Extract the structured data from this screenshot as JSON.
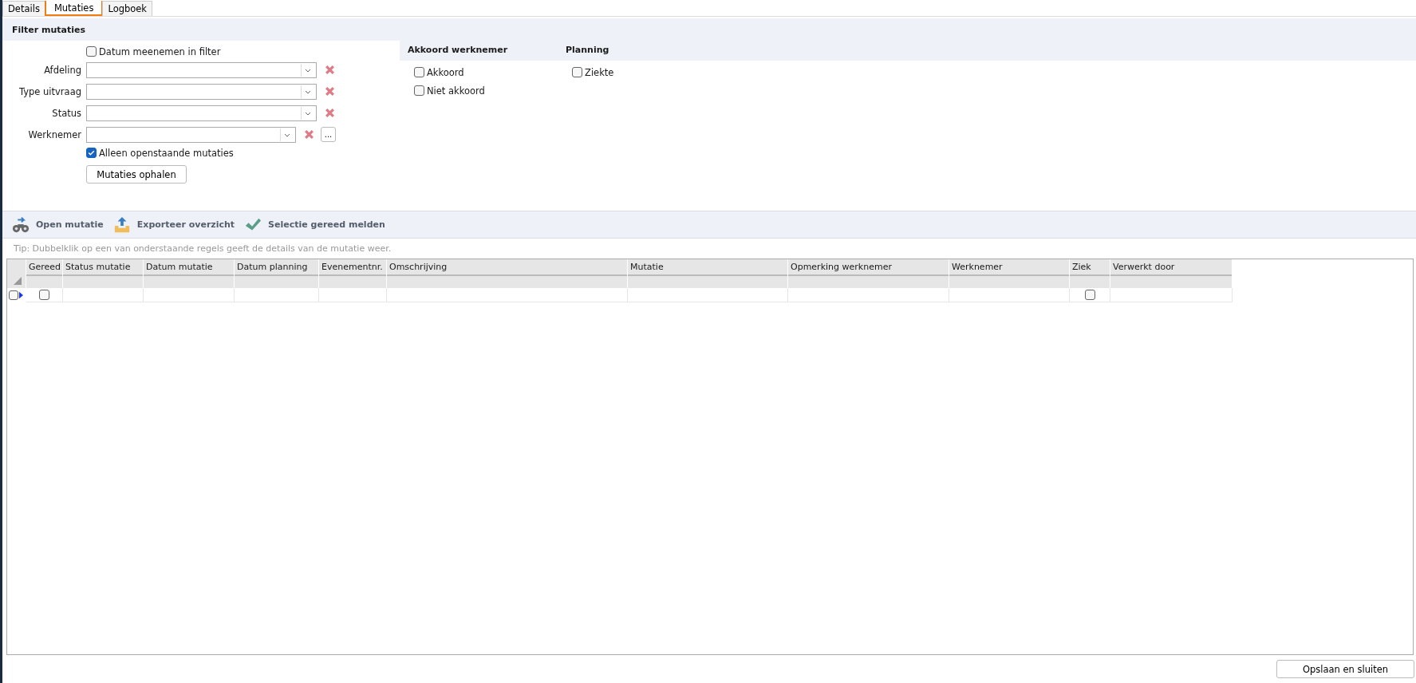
{
  "tabs": [
    {
      "label": "Details",
      "selected": false
    },
    {
      "label": "Mutaties",
      "selected": true
    },
    {
      "label": "Logboek",
      "selected": false
    }
  ],
  "filter": {
    "title": "Filter mutaties",
    "date_option": {
      "label": "Datum meenemen in filter",
      "checked": false
    },
    "fields": [
      {
        "label": "Afdeling"
      },
      {
        "label": "Type uitvraag"
      },
      {
        "label": "Status"
      },
      {
        "label": "Werknemer",
        "browse": "..."
      }
    ],
    "open_only": {
      "label": "Alleen openstaande mutaties",
      "checked": true
    },
    "fetch_button": "Mutaties ophalen"
  },
  "groups": [
    {
      "title": "Akkoord werknemer",
      "options": [
        {
          "label": "Akkoord",
          "checked": false
        },
        {
          "label": "Niet akkoord",
          "checked": false
        }
      ]
    },
    {
      "title": "Planning",
      "options": [
        {
          "label": "Ziekte",
          "checked": false
        }
      ]
    }
  ],
  "toolbar": [
    {
      "kind": "open",
      "label": "Open mutatie"
    },
    {
      "kind": "export",
      "label": "Exporteer overzicht"
    },
    {
      "kind": "done",
      "label": "Selectie gereed melden"
    }
  ],
  "tip": "Tip: Dubbelklik op een van onderstaande regels geeft de details van de mutatie weer.",
  "table": {
    "columns": [
      {
        "label": "Gereed",
        "kind": "check"
      },
      {
        "label": "Status mutatie",
        "kind": "text"
      },
      {
        "label": "Datum mutatie",
        "kind": "text"
      },
      {
        "label": "Datum planning",
        "kind": "text"
      },
      {
        "label": "Evenementnr.",
        "kind": "text"
      },
      {
        "label": "Omschrijving",
        "kind": "text"
      },
      {
        "label": "Mutatie",
        "kind": "text"
      },
      {
        "label": "Opmerking werknemer",
        "kind": "text"
      },
      {
        "label": "Werknemer",
        "kind": "text"
      },
      {
        "label": "Ziek",
        "kind": "check"
      },
      {
        "label": "Verwerkt door",
        "kind": "text"
      }
    ],
    "rows": [
      {
        "selected": false,
        "cells": [
          false,
          "",
          "",
          "",
          "",
          "",
          "",
          "",
          "",
          false,
          ""
        ]
      }
    ]
  },
  "save_button": "Opslaan en sluiten"
}
